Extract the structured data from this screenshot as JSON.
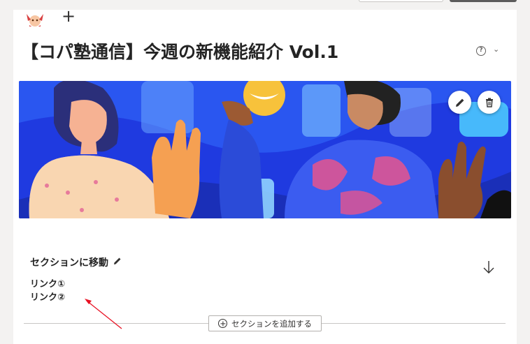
{
  "page": {
    "title": "【コパ塾通信】今週の新機能紹介 Vol.1",
    "add_label": "+",
    "help_glyph": "?",
    "chevron_glyph": "⌄"
  },
  "section": {
    "heading": "セクションに移動",
    "links": [
      "リンク①",
      "リンク②"
    ]
  },
  "add_section": {
    "label": "セクションを追加する"
  },
  "colors": {
    "banner_bg": "#1f3ae0",
    "annotation_arrow": "#e81123",
    "page_bg": "#ffffff",
    "canvas_bg": "#f3f2f1"
  },
  "icons": [
    "avatar",
    "plus-icon",
    "help-icon",
    "chevron-down-icon",
    "edit-icon",
    "trash-icon",
    "pencil-icon",
    "arrow-down-icon",
    "add-circle-icon"
  ]
}
